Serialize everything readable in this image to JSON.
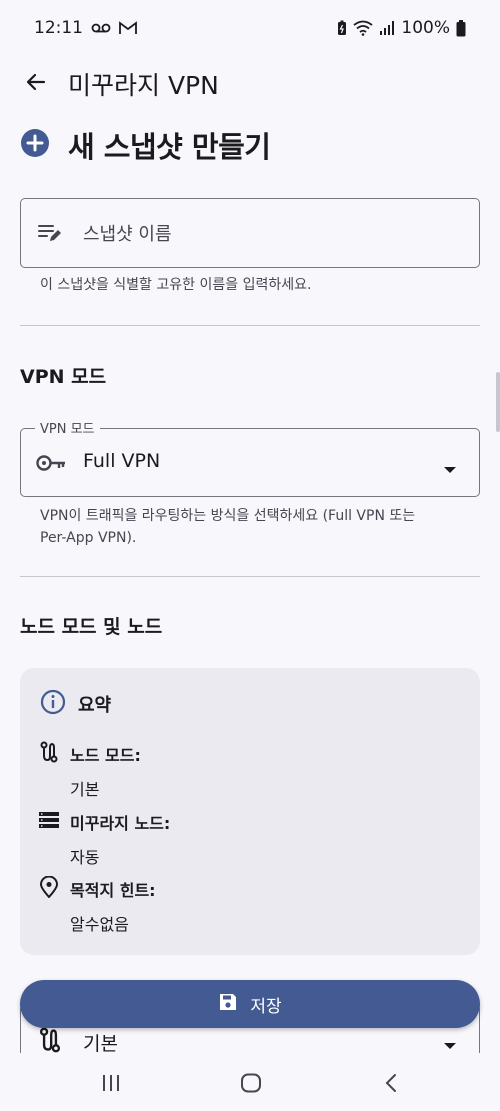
{
  "status_bar": {
    "time": "12:11",
    "battery": "100%",
    "icons": [
      "voicemail-icon",
      "gmail-icon",
      "battery-saver-icon",
      "wifi-icon",
      "signal-icon",
      "battery-icon"
    ]
  },
  "app_bar": {
    "title": "미꾸라지 VPN",
    "back_icon": "arrow-back-icon"
  },
  "page": {
    "title": "새 스냅샷 만들기",
    "title_icon": "add-circle-icon"
  },
  "snapshot_name": {
    "placeholder": "스냅샷 이름",
    "value": "",
    "helper": "이 스냅샷을 식별할 고유한 이름을 입력하세요."
  },
  "vpn_mode_section": {
    "title": "VPN 모드",
    "field_label": "VPN 모드",
    "selected": "Full VPN",
    "helper_line1": "VPN이 트래픽을 라우팅하는 방식을 선택하세요 (Full VPN 또는",
    "helper_line2": "Per-App VPN)."
  },
  "node_section": {
    "title": "노드 모드 및 노드",
    "summary": {
      "title": "요약",
      "rows": [
        {
          "label": "노드 모드:",
          "value": "기본",
          "icon": "route-icon"
        },
        {
          "label": "미꾸라지 노드:",
          "value": "자동",
          "icon": "server-list-icon"
        },
        {
          "label": "목적지 힌트:",
          "value": "알수없음",
          "icon": "location-pin-icon"
        }
      ]
    },
    "node_mode_dropdown": {
      "selected": "기본"
    }
  },
  "save_button": {
    "label": "저장",
    "icon": "save-icon"
  },
  "nav_bar": {
    "buttons": [
      "recent-apps-icon",
      "home-icon",
      "back-nav-icon"
    ]
  },
  "colors": {
    "primary": "#435a92",
    "background": "#f8f7fc",
    "card": "#ebeaf0",
    "outline": "#76767f"
  }
}
